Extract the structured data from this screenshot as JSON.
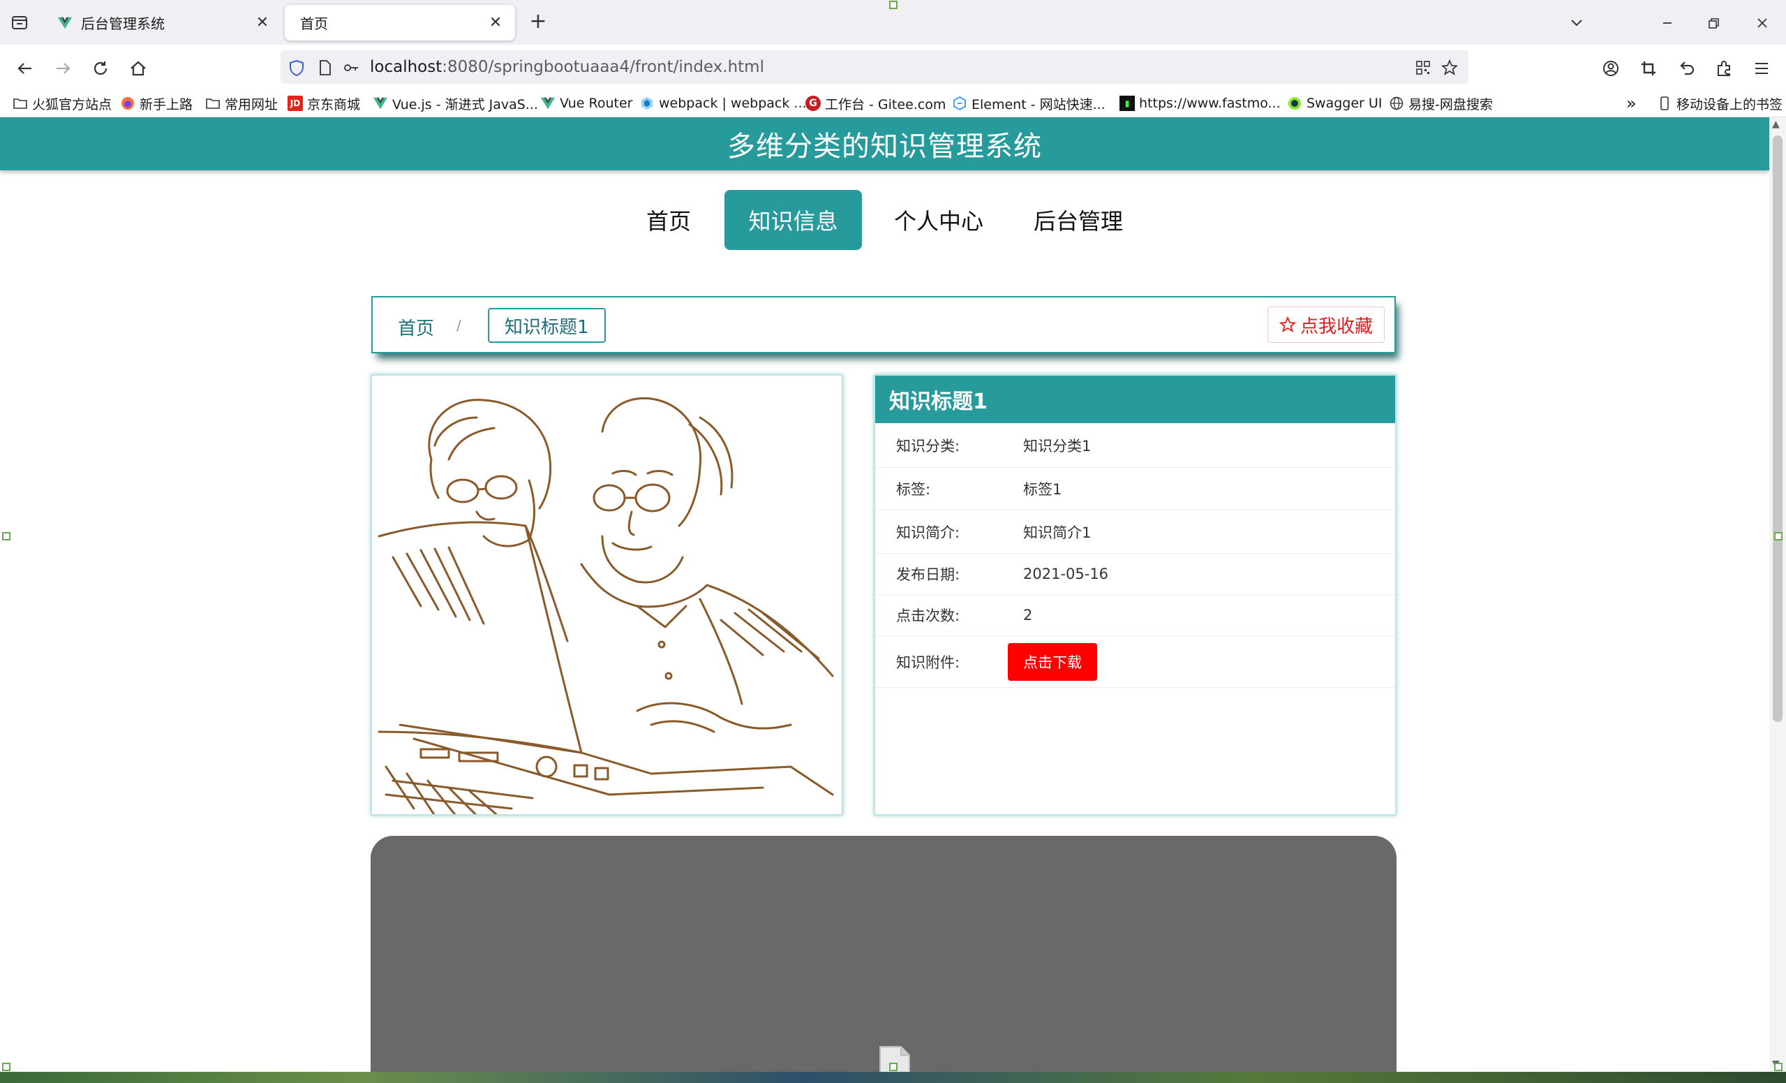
{
  "browser": {
    "tabs": [
      {
        "title": "后台管理系统",
        "active": false
      },
      {
        "title": "首页",
        "active": true
      }
    ],
    "url_host": "localhost",
    "url_path": ":8080/springbootuaaa4/front/index.html",
    "bookmarks": [
      {
        "label": "火狐官方站点",
        "icon": "folder-icon"
      },
      {
        "label": "新手上路",
        "icon": "firefox-icon"
      },
      {
        "label": "常用网址",
        "icon": "folder-icon"
      },
      {
        "label": "京东商城",
        "icon": "jd-icon"
      },
      {
        "label": "Vue.js - 渐进式 JavaS...",
        "icon": "vue-icon"
      },
      {
        "label": "Vue Router",
        "icon": "vue-icon"
      },
      {
        "label": "webpack | webpack ...",
        "icon": "webpack-icon"
      },
      {
        "label": "工作台 - Gitee.com",
        "icon": "gitee-icon"
      },
      {
        "label": "Element - 网站快速...",
        "icon": "element-icon"
      },
      {
        "label": "https://www.fastmo...",
        "icon": "terminal-icon"
      },
      {
        "label": "Swagger UI",
        "icon": "swagger-icon"
      },
      {
        "label": "易搜-网盘搜索",
        "icon": "globe-icon"
      }
    ],
    "mobile_bookmarks": "移动设备上的书签",
    "colors": {
      "tabbar": "#f0f0f4",
      "vue": "#41b883"
    }
  },
  "site": {
    "title": "多维分类的知识管理系统",
    "nav": [
      {
        "label": "首页",
        "active": false
      },
      {
        "label": "知识信息",
        "active": true
      },
      {
        "label": "个人中心",
        "active": false
      },
      {
        "label": "后台管理",
        "active": false
      }
    ],
    "colors": {
      "primary": "#279a9c",
      "danger": "#ff0000"
    }
  },
  "breadcrumb": {
    "home": "首页",
    "separator": "/",
    "current": "知识标题1",
    "favorite_label": "点我收藏"
  },
  "detail": {
    "title": "知识标题1",
    "rows": [
      {
        "label": "知识分类:",
        "value": "知识分类1"
      },
      {
        "label": "标签:",
        "value": "标签1"
      },
      {
        "label": "知识简介:",
        "value": "知识简介1"
      },
      {
        "label": "发布日期:",
        "value": "2021-05-16"
      },
      {
        "label": "点击次数:",
        "value": "2"
      }
    ],
    "attachment_label": "知识附件:",
    "download_label": "点击下载"
  }
}
